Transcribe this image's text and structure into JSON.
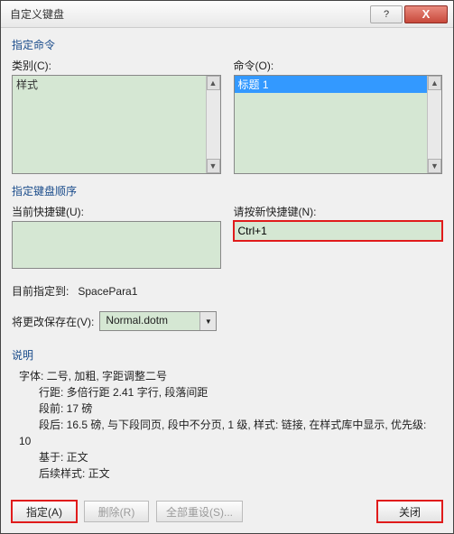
{
  "titlebar": {
    "title": "自定义键盘",
    "help": "?",
    "close": "X"
  },
  "section_command": "指定命令",
  "labels": {
    "categories": "类别(C):",
    "commands": "命令(O):",
    "current_keys": "当前快捷键(U):",
    "new_key": "请按新快捷键(N):",
    "assigned_to": "目前指定到:",
    "save_in": "将更改保存在(V):",
    "description": "说明"
  },
  "section_seq": "指定键盘顺序",
  "categories": {
    "items": [
      "样式"
    ]
  },
  "commands": {
    "items": [
      {
        "label": "标题 1",
        "selected": true
      }
    ]
  },
  "new_key_value": "Ctrl+1",
  "assigned_to_value": "SpacePara1",
  "save_in_value": "Normal.dotm",
  "description_lines": {
    "l1": "字体: 二号, 加粗, 字距调整二号",
    "l2": "行距: 多倍行距 2.41 字行, 段落间距",
    "l3": "段前: 17 磅",
    "l4": "段后: 16.5 磅, 与下段同页, 段中不分页, 1 级, 样式: 链接, 在样式库中显示, 优先级:",
    "l5": "10",
    "l6": "基于: 正文",
    "l7": "后续样式: 正文"
  },
  "buttons": {
    "assign": "指定(A)",
    "remove": "删除(R)",
    "reset": "全部重设(S)...",
    "close": "关闭"
  }
}
